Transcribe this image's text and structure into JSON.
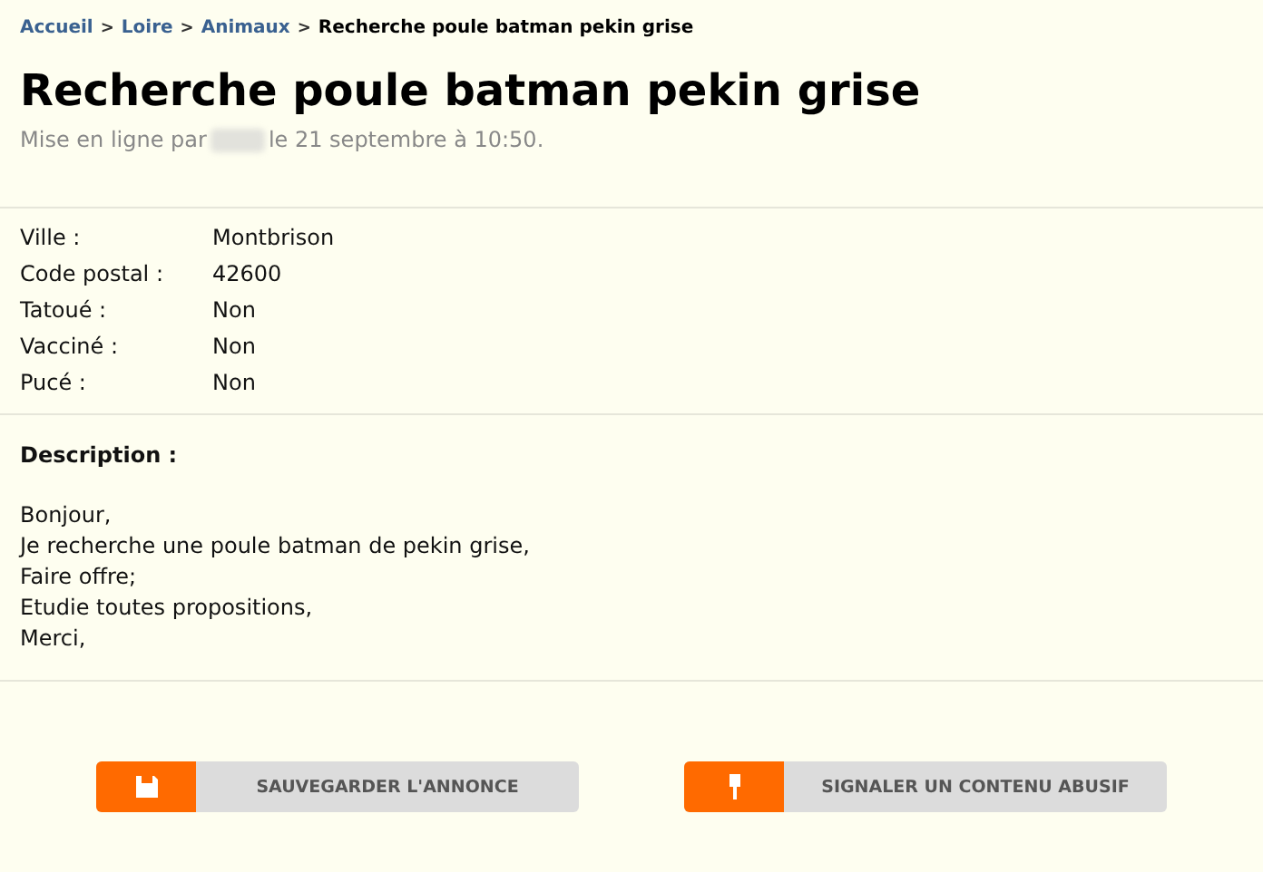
{
  "breadcrumb": [
    {
      "label": "Accueil",
      "kind": "link"
    },
    {
      "label": "Loire",
      "kind": "link"
    },
    {
      "label": "Animaux",
      "kind": "link"
    },
    {
      "label": "Recherche poule batman pekin grise",
      "kind": "current"
    }
  ],
  "separator": ">",
  "title": "Recherche poule batman pekin grise",
  "posted": {
    "prefix": "Mise en ligne par",
    "suffix": "le 21 septembre à 10:50."
  },
  "details": [
    {
      "label": "Ville :",
      "value": "Montbrison"
    },
    {
      "label": "Code postal :",
      "value": "42600"
    },
    {
      "label": "Tatoué :",
      "value": "Non"
    },
    {
      "label": "Vacciné :",
      "value": "Non"
    },
    {
      "label": "Pucé :",
      "value": "Non"
    }
  ],
  "description": {
    "heading": "Description :",
    "lines": [
      "Bonjour,",
      "Je recherche une poule batman de pekin grise,",
      "Faire offre;",
      "Etudie toutes propositions,",
      "Merci,"
    ]
  },
  "actions": [
    {
      "label": "SAUVEGARDER L'ANNONCE",
      "kind": "save"
    },
    {
      "label": "SIGNALER UN CONTENU ABUSIF",
      "kind": "report"
    }
  ]
}
